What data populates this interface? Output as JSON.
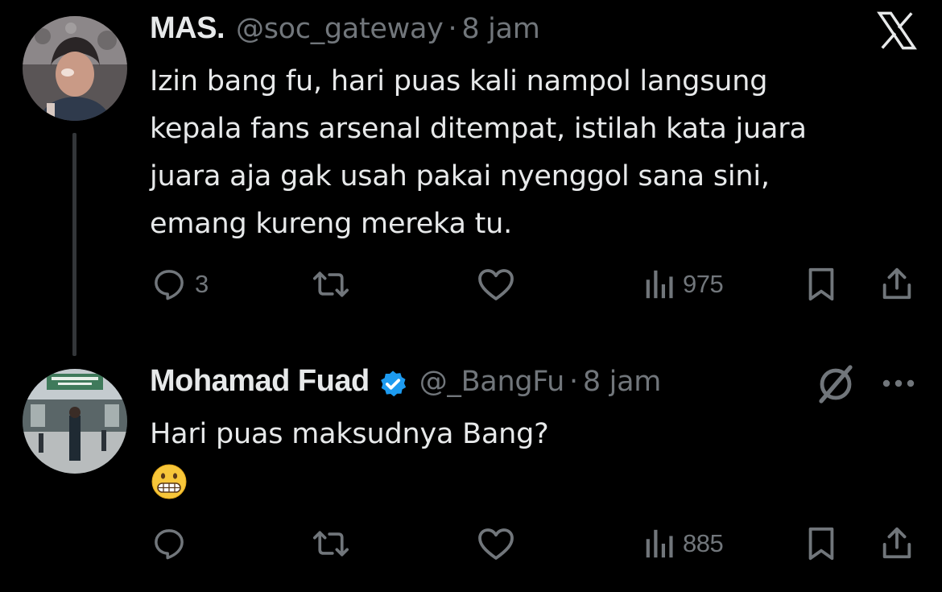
{
  "tweet1": {
    "name": "MAS.",
    "handle": "@soc_gateway",
    "separator": "·",
    "time": "8 jam",
    "lines": [
      "Izin bang fu, hari puas kali nampol langsung",
      "kepala fans arsenal ditempat, istilah kata juara",
      "juara aja gak usah pakai nyenggol sana sini,",
      "emang kureng mereka tu."
    ],
    "reply_count": "3",
    "views": "975"
  },
  "tweet2": {
    "name": "Mohamad Fuad",
    "handle": "@_BangFu",
    "separator": "·",
    "time": "8 jam",
    "text": "Hari puas maksudnya Bang?",
    "views": "885",
    "verified": true
  },
  "icons": {
    "reply": "reply-icon",
    "retweet": "retweet-icon",
    "like": "heart-icon",
    "views": "views-icon",
    "bookmark": "bookmark-icon",
    "share": "share-icon",
    "logo": "x-logo-icon",
    "grok": "grok-icon",
    "more": "more-icon",
    "emoji": "grimacing-face-emoji"
  },
  "colors": {
    "background": "#000000",
    "text": "#e7e9ea",
    "secondary": "#71767b",
    "verified": "#1d9bf0"
  }
}
